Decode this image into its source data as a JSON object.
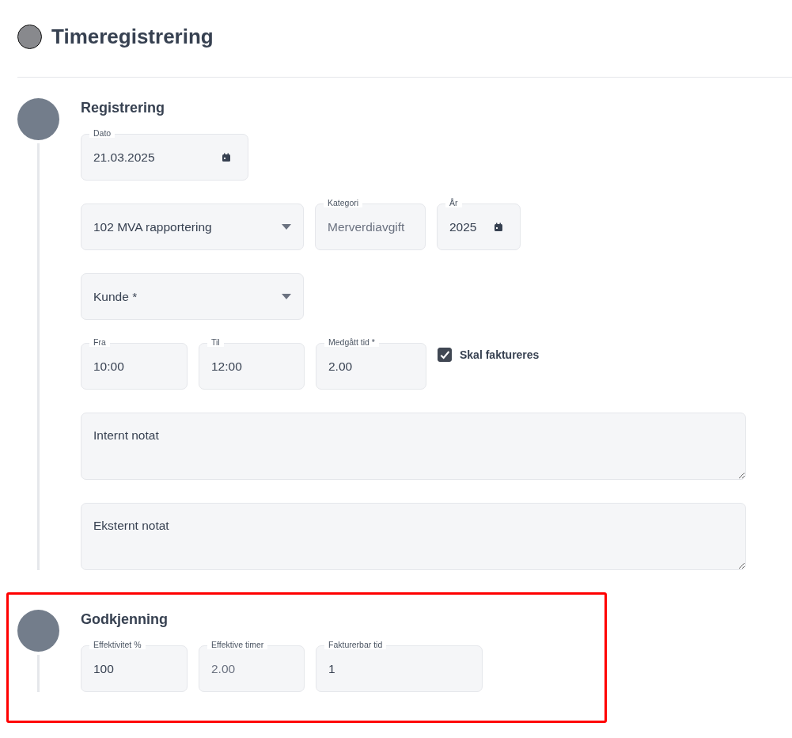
{
  "title": "Timeregistrering",
  "sections": [
    {
      "heading": "Registrering",
      "highlighted": false,
      "lines": [
        {
          "fields": [
            {
              "kind": "date",
              "label": "Dato",
              "value": "21.03.2025",
              "disabled": false
            }
          ]
        },
        {
          "fields": [
            {
              "kind": "select",
              "value": "102 MVA rapportering"
            },
            {
              "kind": "text",
              "label": "Kategori",
              "value": "Merverdiavgift",
              "disabled": true
            },
            {
              "kind": "date",
              "label": "År",
              "value": "2025",
              "disabled": false
            }
          ]
        },
        {
          "fields": [
            {
              "kind": "select",
              "placeholder": "Kunde *"
            }
          ]
        },
        {
          "fields": [
            {
              "kind": "text",
              "label": "Fra",
              "value": "10:00",
              "disabled": false
            },
            {
              "kind": "text",
              "label": "Til",
              "value": "12:00",
              "disabled": false
            },
            {
              "kind": "text",
              "label": "Medgått tid *",
              "value": "2.00",
              "disabled": false
            },
            {
              "kind": "checkbox",
              "label": "Skal faktureres",
              "checked": true
            }
          ]
        },
        {
          "fields": [
            {
              "kind": "textarea",
              "placeholder": "Internt notat"
            }
          ]
        },
        {
          "fields": [
            {
              "kind": "textarea",
              "placeholder": "Eksternt notat"
            }
          ]
        }
      ]
    },
    {
      "heading": "Godkjenning",
      "highlighted": true,
      "lines": [
        {
          "fields": [
            {
              "kind": "text",
              "label": "Effektivitet %",
              "value": "100",
              "disabled": false
            },
            {
              "kind": "text",
              "label": "Effektive timer",
              "value": "2.00",
              "disabled": true
            },
            {
              "kind": "text",
              "label": "Fakturerbar tid",
              "value": "1",
              "disabled": false
            }
          ]
        }
      ]
    }
  ]
}
